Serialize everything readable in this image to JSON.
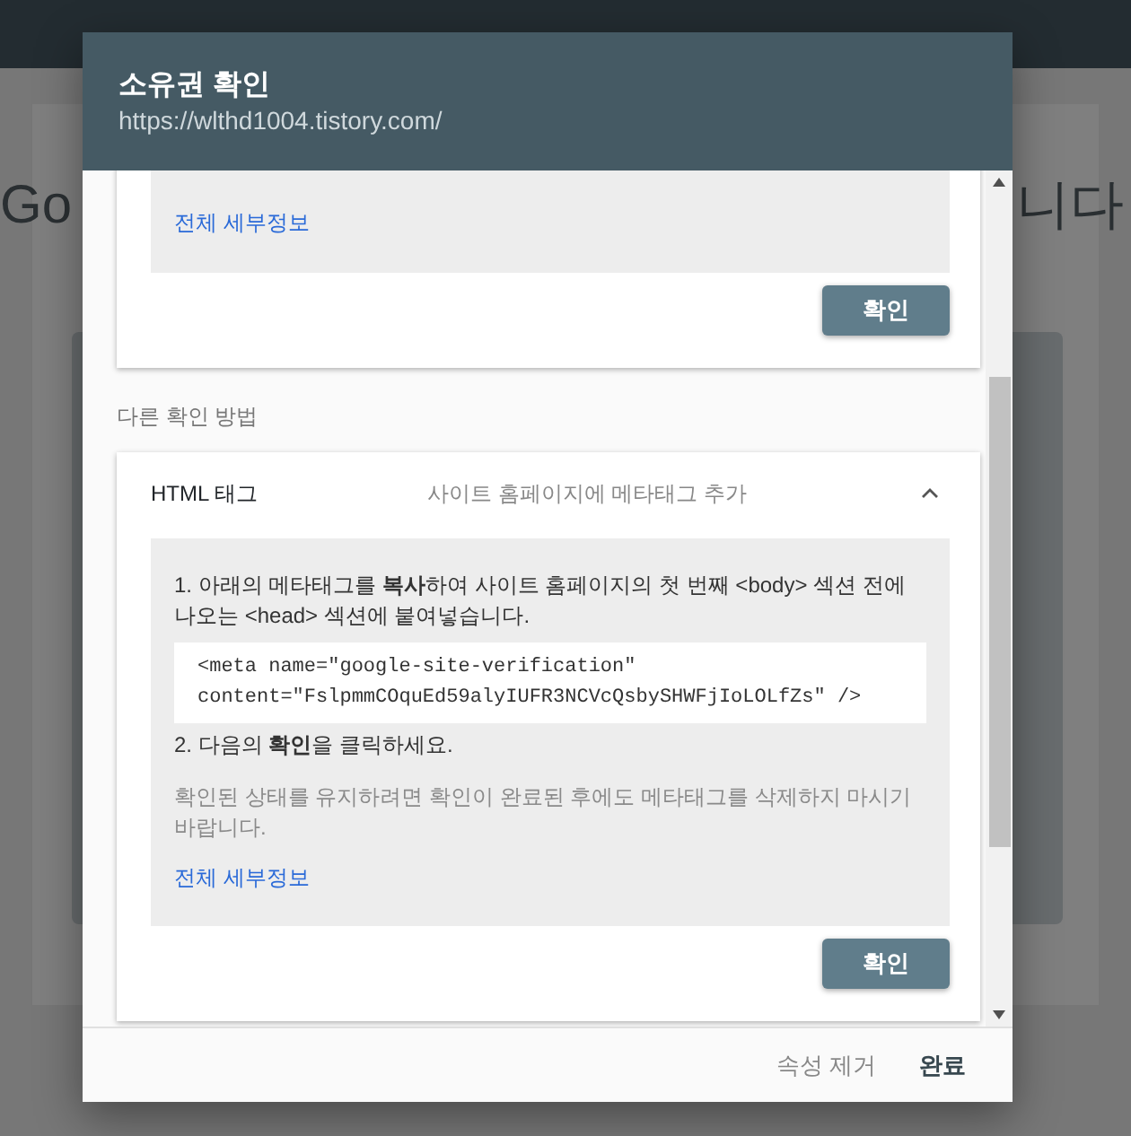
{
  "background": {
    "heading_start": "Go",
    "heading_end": "니다"
  },
  "dialog": {
    "title": "소유권 확인",
    "subtitle": "https://wlthd1004.tistory.com/",
    "current_method": {
      "link": "전체 세부정보",
      "button": "확인"
    },
    "other_methods_label": "다른 확인 방법",
    "methods": [
      {
        "name": "HTML 태그",
        "description": "사이트 홈페이지에 메타태그 추가",
        "expanded": true,
        "steps": [
          "1. 아래의 메타태그를 **복사**하여 사이트 홈페이지의 첫 번째 <body> 섹션 전에 나오는 <head> 섹션에 붙여넣습니다.",
          "2. 다음의 **확인**을 클릭하세요."
        ],
        "code": "<meta name=\"google-site-verification\"\ncontent=\"FslpmmCOquEd59alyIUFR3NCVcQsbySHWFjIoLOLfZs\" />",
        "note": "확인된 상태를 유지하려면 확인이 완료된 후에도 메타태그를 삭제하지 마시기 바랍니다.",
        "link": "전체 세부정보",
        "button": "확인"
      }
    ],
    "footer_buttons": [
      {
        "label": "속성 제거",
        "kind": "secondary"
      },
      {
        "label": "완료",
        "kind": "primary"
      }
    ]
  }
}
